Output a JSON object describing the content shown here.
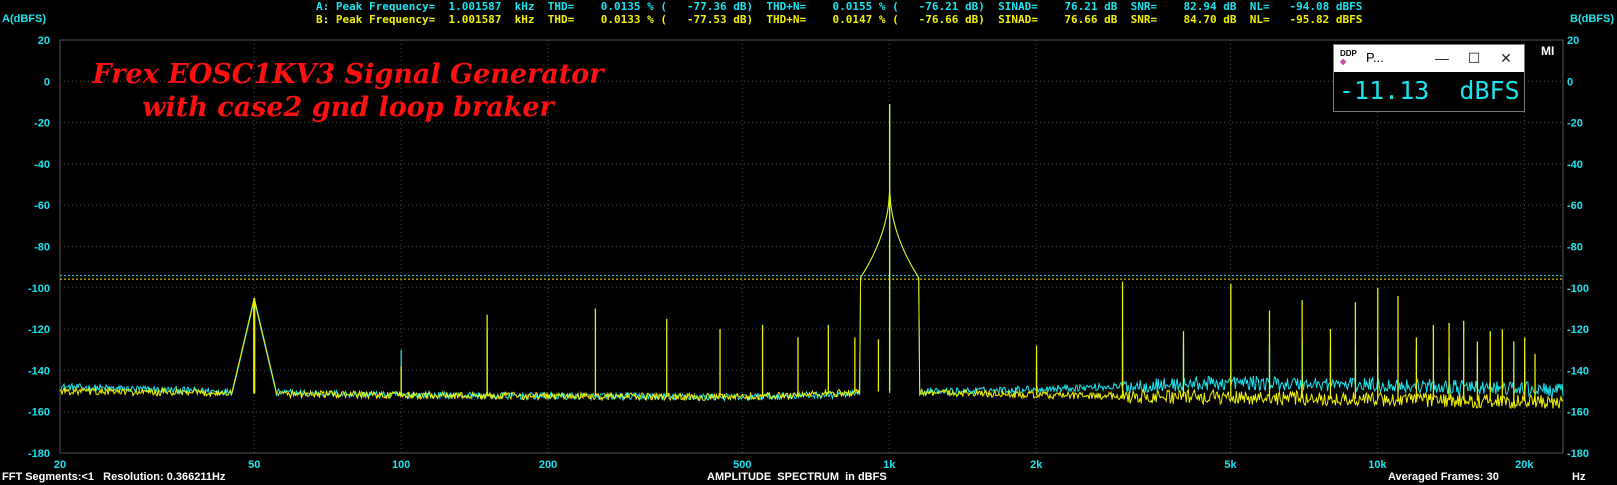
{
  "stats": {
    "line_a": "A: Peak Frequency=  1.001587  kHz  THD=    0.0135 % (   -77.36 dB)  THD+N=    0.0155 % (   -76.21 dB)  SINAD=    76.21 dB  SNR=    82.94 dB  NL=   -94.08 dBFS",
    "line_b": "B: Peak Frequency=  1.001587  kHz  THD=    0.0133 % (   -77.53 dB)  THD+N=    0.0147 % (   -76.66 dB)  SINAD=    76.66 dB  SNR=    84.70 dB  NL=   -95.82 dBFS"
  },
  "overlay": {
    "title_line1": "Frex EOSC1KV3 Signal Generator",
    "title_line2": "with case2 gnd loop braker"
  },
  "level_window": {
    "logo": "DDP",
    "title": "P...",
    "minimize_icon": "minimize-icon",
    "maximize_icon": "maximize-icon",
    "close_icon": "close-icon",
    "readout": "-11.13  dBFS"
  },
  "corner_tag": "MI",
  "bottom": {
    "left": "FFT Segments:<1   Resolution: 0.366211Hz",
    "center": "AMPLITUDE  SPECTRUM  in dBFS",
    "right": "Averaged Frames: 30",
    "hz": "Hz"
  },
  "colors": {
    "background": "#000000",
    "grid": "#4a4a4a",
    "axis_text": "#19e3ee",
    "series_a": "#19e3ee",
    "series_b": "#f0f000",
    "title_red": "#ff1010"
  },
  "chart_data": {
    "type": "line",
    "title": "AMPLITUDE  SPECTRUM  in dBFS",
    "xlabel": "Hz",
    "ylabel_left": "A(dBFS)",
    "ylabel_right": "B(dBFS)",
    "xscale": "log",
    "xlim": [
      20,
      24000
    ],
    "ylim": [
      -180,
      20
    ],
    "grid": true,
    "x_ticks": [
      {
        "v": 20,
        "label": "20"
      },
      {
        "v": 50,
        "label": "50"
      },
      {
        "v": 100,
        "label": "100"
      },
      {
        "v": 200,
        "label": "200"
      },
      {
        "v": 500,
        "label": "500"
      },
      {
        "v": 1000,
        "label": "1k"
      },
      {
        "v": 2000,
        "label": "2k"
      },
      {
        "v": 5000,
        "label": "5k"
      },
      {
        "v": 10000,
        "label": "10k"
      },
      {
        "v": 20000,
        "label": "20k"
      }
    ],
    "y_ticks": [
      20,
      0,
      -20,
      -40,
      -60,
      -80,
      -100,
      -120,
      -140,
      -160,
      -180
    ],
    "series": [
      {
        "name": "A",
        "color": "#19e3ee",
        "noise_floor": [
          [
            20,
            -148
          ],
          [
            40,
            -150
          ],
          [
            100,
            -152
          ],
          [
            500,
            -153
          ],
          [
            1000,
            -151
          ],
          [
            2000,
            -149
          ],
          [
            5000,
            -146
          ],
          [
            10000,
            -147
          ],
          [
            20000,
            -149
          ],
          [
            24000,
            -150
          ]
        ],
        "noise_level": -94.08,
        "peaks": [
          {
            "f": 50,
            "db": -106
          },
          {
            "f": 100,
            "db": -130
          },
          {
            "f": 150,
            "db": -120
          },
          {
            "f": 1001.587,
            "db": -11.13
          },
          {
            "f": 2003,
            "db": -138
          },
          {
            "f": 3005,
            "db": -125
          },
          {
            "f": 4006,
            "db": -128
          },
          {
            "f": 5008,
            "db": -125
          },
          {
            "f": 6010,
            "db": -128
          },
          {
            "f": 7011,
            "db": -126
          },
          {
            "f": 8013,
            "db": -130
          },
          {
            "f": 9014,
            "db": -128
          },
          {
            "f": 10016,
            "db": -133
          },
          {
            "f": 12019,
            "db": -130
          },
          {
            "f": 14022,
            "db": -134
          },
          {
            "f": 16025,
            "db": -132
          },
          {
            "f": 18029,
            "db": -135
          },
          {
            "f": 20032,
            "db": -134
          }
        ]
      },
      {
        "name": "B",
        "color": "#f0f000",
        "noise_floor": [
          [
            20,
            -150
          ],
          [
            40,
            -151
          ],
          [
            100,
            -152
          ],
          [
            500,
            -153
          ],
          [
            1000,
            -150
          ],
          [
            2000,
            -152
          ],
          [
            5000,
            -153
          ],
          [
            10000,
            -154
          ],
          [
            20000,
            -155
          ],
          [
            24000,
            -156
          ]
        ],
        "noise_level": -95.82,
        "peaks": [
          {
            "f": 50,
            "db": -105
          },
          {
            "f": 100,
            "db": -138
          },
          {
            "f": 150,
            "db": -113
          },
          {
            "f": 250,
            "db": -110
          },
          {
            "f": 350,
            "db": -115
          },
          {
            "f": 450,
            "db": -120
          },
          {
            "f": 550,
            "db": -118
          },
          {
            "f": 650,
            "db": -124
          },
          {
            "f": 750,
            "db": -118
          },
          {
            "f": 850,
            "db": -124
          },
          {
            "f": 950,
            "db": -125
          },
          {
            "f": 1001.587,
            "db": -11.13
          },
          {
            "f": 2003,
            "db": -128
          },
          {
            "f": 3005,
            "db": -97
          },
          {
            "f": 4006,
            "db": -121
          },
          {
            "f": 5008,
            "db": -98
          },
          {
            "f": 6010,
            "db": -111
          },
          {
            "f": 7011,
            "db": -106
          },
          {
            "f": 8013,
            "db": -120
          },
          {
            "f": 9014,
            "db": -107
          },
          {
            "f": 10016,
            "db": -100
          },
          {
            "f": 11018,
            "db": -104
          },
          {
            "f": 12019,
            "db": -124
          },
          {
            "f": 13021,
            "db": -118
          },
          {
            "f": 14022,
            "db": -117
          },
          {
            "f": 15024,
            "db": -116
          },
          {
            "f": 16025,
            "db": -126
          },
          {
            "f": 17027,
            "db": -121
          },
          {
            "f": 18029,
            "db": -120
          },
          {
            "f": 19030,
            "db": -126
          },
          {
            "f": 20032,
            "db": -124
          },
          {
            "f": 21033,
            "db": -132
          }
        ]
      }
    ]
  }
}
